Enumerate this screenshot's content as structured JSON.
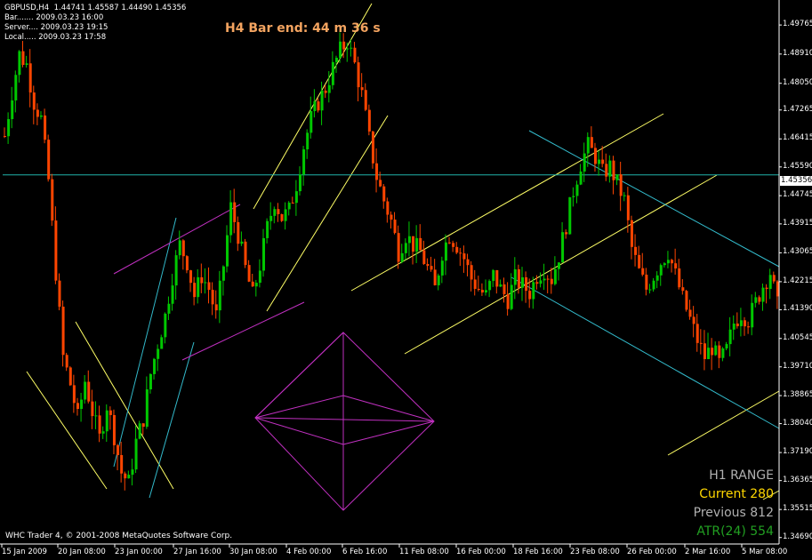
{
  "header": {
    "symbol_line": "GBPUSD,H4  1.44741 1.45587 1.44490 1.45356",
    "bar_line": "Bar....... 2009.03.23 16:00",
    "server_line": "Server.... 2009.03.23 19:15",
    "local_line": "Local..... 2009.03.23 17:58"
  },
  "bar_timer": "H4 Bar end: 44 m 36 s",
  "footer_copyright": "WHC Trader 4, © 2001-2008 MetaQuotes Software Corp.",
  "range_panel": {
    "title": "H1 RANGE",
    "current": "Current 280",
    "previous": "Previous 812",
    "atr": "ATR(24) 554"
  },
  "current_price_label": "1.45356",
  "colors": {
    "background": "#000000",
    "bull_candle": "#00c800",
    "bear_candle": "#ff4500",
    "trendline_yellow": "#ffff66",
    "trendline_cyan": "#33bbcc",
    "trendline_magenta": "#c030c0",
    "price_line": "#20b2aa",
    "panel_title": "#b0b0b0",
    "panel_current": "#ffd700",
    "panel_previous": "#b0b0b0",
    "panel_atr": "#22a022",
    "timer_text": "#f4a460"
  },
  "chart_data": {
    "type": "candlestick",
    "symbol": "GBPUSD",
    "timeframe": "H4",
    "ylim": [
      1.345,
      1.505
    ],
    "price_ticks": [
      "1.49765",
      "1.48910",
      "1.48050",
      "1.47265",
      "1.46415",
      "1.45590",
      "1.44745",
      "1.43915",
      "1.43065",
      "1.42215",
      "1.41390",
      "1.40545",
      "1.39710",
      "1.38865",
      "1.38040",
      "1.37190",
      "1.36365",
      "1.35515",
      "1.34690"
    ],
    "date_ticks": [
      "15 Jan 2009",
      "20 Jan 08:00",
      "23 Jan 00:00",
      "27 Jan 16:00",
      "30 Jan 08:00",
      "4 Feb 00:00",
      "6 Feb 16:00",
      "11 Feb 08:00",
      "16 Feb 00:00",
      "18 Feb 16:00",
      "23 Feb 08:00",
      "26 Feb 00:00",
      "2 Mar 16:00",
      "5 Mar 08:00"
    ],
    "current_price": 1.45356,
    "close_path": [
      [
        0,
        1.465
      ],
      [
        2,
        1.478
      ],
      [
        4,
        1.489
      ],
      [
        6,
        1.486
      ],
      [
        8,
        1.475
      ],
      [
        10,
        1.47
      ],
      [
        12,
        1.452
      ],
      [
        14,
        1.425
      ],
      [
        16,
        1.4
      ],
      [
        18,
        1.392
      ],
      [
        20,
        1.382
      ],
      [
        22,
        1.393
      ],
      [
        24,
        1.384
      ],
      [
        26,
        1.376
      ],
      [
        28,
        1.386
      ],
      [
        30,
        1.377
      ],
      [
        32,
        1.366
      ],
      [
        34,
        1.363
      ],
      [
        36,
        1.375
      ],
      [
        38,
        1.382
      ],
      [
        40,
        1.395
      ],
      [
        42,
        1.404
      ],
      [
        44,
        1.412
      ],
      [
        46,
        1.424
      ],
      [
        48,
        1.433
      ],
      [
        50,
        1.428
      ],
      [
        52,
        1.418
      ],
      [
        54,
        1.424
      ],
      [
        56,
        1.42
      ],
      [
        58,
        1.412
      ],
      [
        60,
        1.427
      ],
      [
        62,
        1.444
      ],
      [
        64,
        1.436
      ],
      [
        66,
        1.426
      ],
      [
        68,
        1.418
      ],
      [
        70,
        1.427
      ],
      [
        72,
        1.438
      ],
      [
        74,
        1.446
      ],
      [
        76,
        1.441
      ],
      [
        78,
        1.443
      ],
      [
        80,
        1.451
      ],
      [
        82,
        1.462
      ],
      [
        84,
        1.47
      ],
      [
        86,
        1.475
      ],
      [
        88,
        1.479
      ],
      [
        90,
        1.485
      ],
      [
        92,
        1.49
      ],
      [
        94,
        1.493
      ],
      [
        96,
        1.486
      ],
      [
        98,
        1.477
      ],
      [
        100,
        1.464
      ],
      [
        102,
        1.453
      ],
      [
        104,
        1.446
      ],
      [
        106,
        1.44
      ],
      [
        108,
        1.431
      ],
      [
        110,
        1.436
      ],
      [
        112,
        1.433
      ],
      [
        114,
        1.431
      ],
      [
        116,
        1.426
      ],
      [
        118,
        1.42
      ],
      [
        120,
        1.431
      ],
      [
        122,
        1.436
      ],
      [
        124,
        1.433
      ],
      [
        126,
        1.429
      ],
      [
        128,
        1.423
      ],
      [
        130,
        1.42
      ],
      [
        132,
        1.418
      ],
      [
        134,
        1.424
      ],
      [
        136,
        1.42
      ],
      [
        138,
        1.417
      ],
      [
        140,
        1.423
      ],
      [
        142,
        1.421
      ],
      [
        144,
        1.419
      ],
      [
        146,
        1.424
      ],
      [
        148,
        1.426
      ],
      [
        150,
        1.423
      ],
      [
        152,
        1.43
      ],
      [
        154,
        1.439
      ],
      [
        156,
        1.449
      ],
      [
        158,
        1.457
      ],
      [
        160,
        1.462
      ],
      [
        162,
        1.459
      ],
      [
        164,
        1.454
      ],
      [
        166,
        1.456
      ],
      [
        168,
        1.451
      ],
      [
        170,
        1.446
      ],
      [
        172,
        1.432
      ],
      [
        174,
        1.425
      ],
      [
        176,
        1.42
      ],
      [
        178,
        1.424
      ],
      [
        180,
        1.428
      ],
      [
        182,
        1.431
      ],
      [
        184,
        1.424
      ],
      [
        186,
        1.417
      ],
      [
        188,
        1.411
      ],
      [
        190,
        1.405
      ],
      [
        192,
        1.4
      ],
      [
        194,
        1.403
      ],
      [
        196,
        1.398
      ],
      [
        198,
        1.402
      ],
      [
        200,
        1.41
      ],
      [
        202,
        1.413
      ],
      [
        204,
        1.411
      ],
      [
        206,
        1.416
      ],
      [
        208,
        1.421
      ],
      [
        210,
        1.425
      ],
      [
        212,
        1.415
      ]
    ]
  }
}
